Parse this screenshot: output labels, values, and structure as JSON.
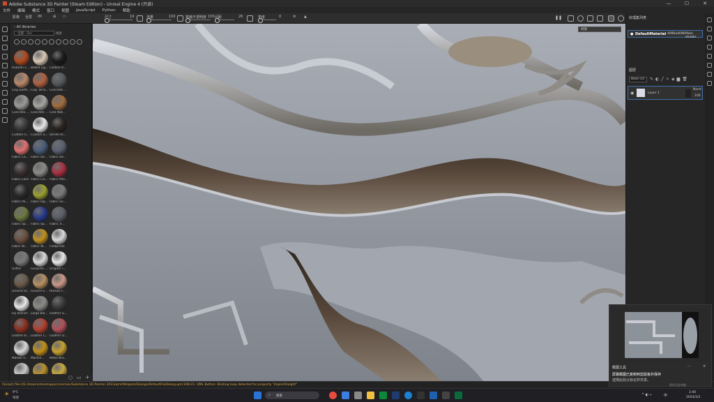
{
  "window": {
    "title": "Adobe Substance 3D Painter (Steam Edition) - Unreal Engine 4 (只读)",
    "minimize": "—",
    "maximize": "☐",
    "close": "✕"
  },
  "menu": [
    "文件",
    "编辑",
    "模式",
    "窗口",
    "视图",
    "JavaScript",
    "Python",
    "帮助"
  ],
  "toolbar": {
    "mode1": "影像",
    "mode2": "全屏",
    "mode3": "IM",
    "size_label": "尺寸",
    "size_value": "19",
    "flow_label": "流量",
    "flow_value": "100",
    "stroke_label": "笔触不透明度",
    "stroke_value": "100",
    "spacing_label": "间距",
    "spacing_value": "26",
    "jitter_label": "角度",
    "jitter_value": "0"
  },
  "shelf": {
    "breadcrumb": "All libraries",
    "search_placeholder": "全部 - Sm",
    "search_sub": "搜索",
    "materials": [
      {
        "label": "Autumn L...",
        "color": "#b04a1e"
      },
      {
        "label": "Baked Lig...",
        "color": "#d9c7b4"
      },
      {
        "label": "Carbon Fi...",
        "color": "#1a1a1a"
      },
      {
        "label": "Clay Earth...",
        "color": "#b9886a"
      },
      {
        "label": "Clay Terra...",
        "color": "#b06040"
      },
      {
        "label": "Concrete ...",
        "color": "#55585c"
      },
      {
        "label": "Concrete ...",
        "color": "#9a9a98"
      },
      {
        "label": "Concrete ...",
        "color": "#a5a5a2"
      },
      {
        "label": "Cork Nat...",
        "color": "#a06b3e"
      },
      {
        "label": "Custom S...",
        "color": "#3a3a3a"
      },
      {
        "label": "Custom S...",
        "color": "#e8e8e8"
      },
      {
        "label": "Denim Ri...",
        "color": "#2a2420"
      },
      {
        "label": "Fabric Ca...",
        "color": "#e07070"
      },
      {
        "label": "Fabric De...",
        "color": "#4a5c7a"
      },
      {
        "label": "Fabric De...",
        "color": "#5a6070"
      },
      {
        "label": "Fabric Lace",
        "color": "#3a3032"
      },
      {
        "label": "Fabric Lin...",
        "color": "#8a8a88"
      },
      {
        "label": "Fabric Mel...",
        "color": "#a83040"
      },
      {
        "label": "Fabric Pa...",
        "color": "#2a2a2a"
      },
      {
        "label": "Fabric Rip...",
        "color": "#9aa030"
      },
      {
        "label": "Fabric Sn...",
        "color": "#7a7a7a"
      },
      {
        "label": "Fabric Sp...",
        "color": "#6a7840"
      },
      {
        "label": "Fabric Sp...",
        "color": "#283a8a"
      },
      {
        "label": "Fabric Tr...",
        "color": "#5a5e66"
      },
      {
        "label": "Fabric W...",
        "color": "#6a5040"
      },
      {
        "label": "Fabric W...",
        "color": "#c09020"
      },
      {
        "label": "Footprints",
        "color": "#d8d8d8"
      },
      {
        "label": "Glitter",
        "color": "#7a7a7a"
      },
      {
        "label": "Gouache ...",
        "color": "#d8d8d8"
      },
      {
        "label": "Graphit T...",
        "color": "#e8e8e8"
      },
      {
        "label": "Ground St...",
        "color": "#6a5a4a"
      },
      {
        "label": "Ground S...",
        "color": "#b89060"
      },
      {
        "label": "Human F...",
        "color": "#c89888"
      },
      {
        "label": "Ivy Branch",
        "color": "#e8e8e8"
      },
      {
        "label": "Large Bar...",
        "color": "#8a8a86"
      },
      {
        "label": "Leather G...",
        "color": "#3a3a3a"
      },
      {
        "label": "Leather B...",
        "color": "#8a3020"
      },
      {
        "label": "Leather C...",
        "color": "#b04030"
      },
      {
        "label": "Leather D...",
        "color": "#b05058"
      },
      {
        "label": "Marble V...",
        "color": "#d8d8d8"
      },
      {
        "label": "Machin...",
        "color": "#c0901a"
      },
      {
        "label": "Metal Bra...",
        "color": "#c8a030"
      },
      {
        "label": "",
        "color": "#c8c8c8"
      },
      {
        "label": "",
        "color": "#b89030"
      },
      {
        "label": "",
        "color": "#c8a840"
      }
    ]
  },
  "texture_set": {
    "header": "纹理集列表",
    "material_name": "DefaultMaterial",
    "resolution": "4096x4096",
    "shader": "Main shader"
  },
  "layers": {
    "header": "图层",
    "channel": "Base col",
    "layer_name": "Layer 1",
    "blend": "Norm",
    "opacity": "100"
  },
  "viewport_dropdown": "材质",
  "status": {
    "message": "[Script] file:///E:/steam/steamapps/common/Substance 3D Painter 2023/qml/Widgets/Dialogs/DefaultFileDialog.qml:308:21: QML Button: Binding loop detected for property \"implicitHeight\""
  },
  "toast": {
    "app": "截图工具",
    "line1": "屏幕截图已复制到剪贴板并保存",
    "line2": "选择此处以标记并共享。",
    "footer": "保存至此电脑"
  },
  "taskbar": {
    "weather_temp": "9°C",
    "weather_desc": "晴朗",
    "search": "搜索",
    "time": "2:40",
    "date": "2024/3/3",
    "lang": "中"
  },
  "colors": {
    "accent": "#d34a2a",
    "warning_text": "#d8a040"
  }
}
